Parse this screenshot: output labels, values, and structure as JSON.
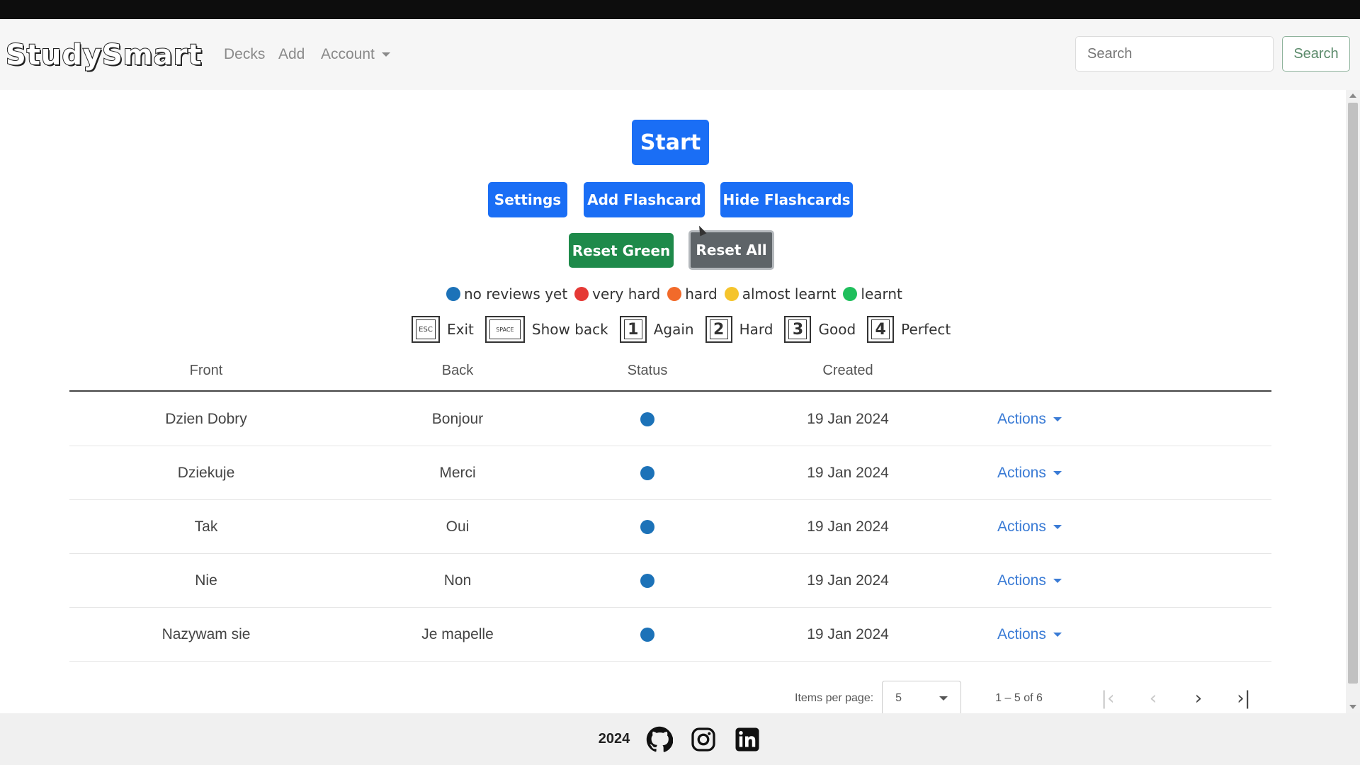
{
  "navbar": {
    "brand": "StudySmart",
    "links": [
      "Decks",
      "Add"
    ],
    "account_label": "Account",
    "search_placeholder": "Search",
    "search_button": "Search"
  },
  "controls": {
    "start": "Start",
    "settings": "Settings",
    "add_flashcard": "Add Flashcard",
    "hide_flashcards": "Hide Flashcards",
    "reset_green": "Reset Green",
    "reset_all": "Reset All"
  },
  "legend": [
    {
      "label": "no reviews yet",
      "color": "#1c72b8"
    },
    {
      "label": "very hard",
      "color": "#e53935"
    },
    {
      "label": "hard",
      "color": "#f26a2a"
    },
    {
      "label": "almost learnt",
      "color": "#f5c42c"
    },
    {
      "label": "learnt",
      "color": "#1fbf5c"
    }
  ],
  "shortcuts": [
    {
      "key": "ESC",
      "label": "Exit"
    },
    {
      "key": "SPACE",
      "label": "Show back"
    },
    {
      "key": "1",
      "label": "Again"
    },
    {
      "key": "2",
      "label": "Hard"
    },
    {
      "key": "3",
      "label": "Good"
    },
    {
      "key": "4",
      "label": "Perfect"
    }
  ],
  "table": {
    "columns": [
      "Front",
      "Back",
      "Status",
      "Created"
    ],
    "rows": [
      {
        "front": "Dzien Dobry",
        "back": "Bonjour",
        "created": "19 Jan 2024",
        "actions": "Actions"
      },
      {
        "front": "Dziekuje",
        "back": "Merci",
        "created": "19 Jan 2024",
        "actions": "Actions"
      },
      {
        "front": "Tak",
        "back": "Oui",
        "created": "19 Jan 2024",
        "actions": "Actions"
      },
      {
        "front": "Nie",
        "back": "Non",
        "created": "19 Jan 2024",
        "actions": "Actions"
      },
      {
        "front": "Nazywam sie",
        "back": "Je mapelle",
        "created": "19 Jan 2024",
        "actions": "Actions"
      }
    ]
  },
  "paginator": {
    "items_per_page_label": "Items per page:",
    "items_per_page_value": "5",
    "range": "1 – 5 of 6"
  },
  "footer": {
    "year": "2024",
    "icons": [
      "github-icon",
      "instagram-icon",
      "linkedin-icon"
    ]
  }
}
